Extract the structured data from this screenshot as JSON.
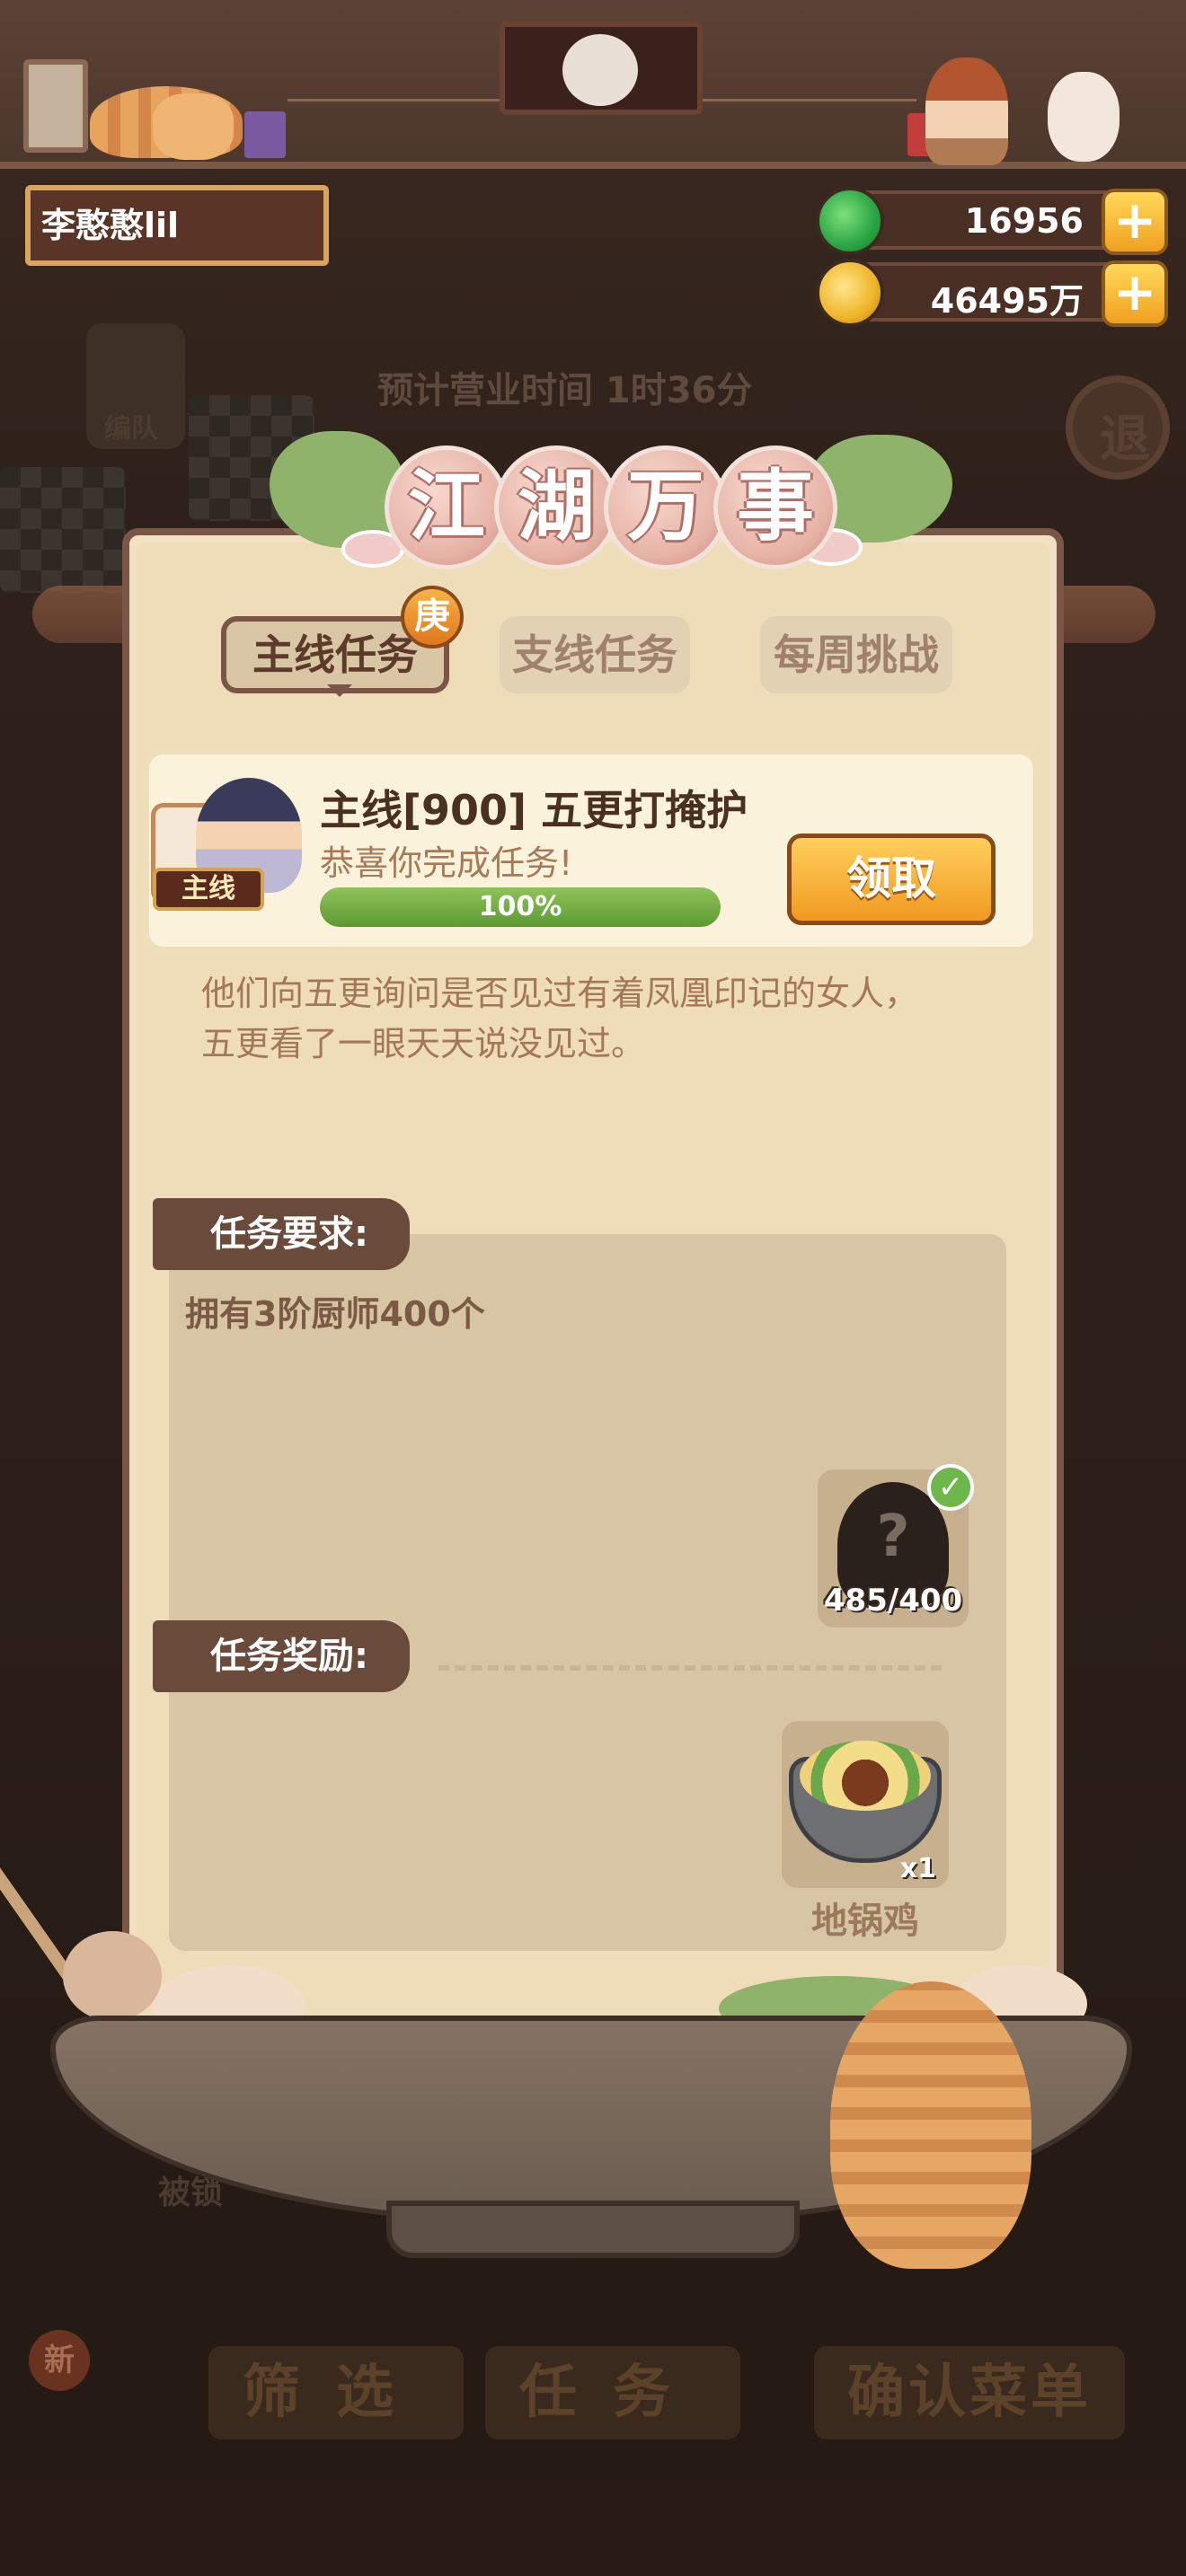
{
  "player": {
    "name": "李憨憨lil"
  },
  "currency": {
    "jade_amount": "16956",
    "coin_amount": "46495万"
  },
  "background": {
    "business_time": "预计营业时间  1时36分",
    "team_label": "编队",
    "exit_label": "退",
    "locked_label": "被锁",
    "filter_label": "筛选",
    "task_label": "任务",
    "confirm_menu_label": "确认菜单",
    "new_badge": "新"
  },
  "panel": {
    "title_chars": [
      "江",
      "湖",
      "万",
      "事"
    ],
    "tabs": [
      {
        "label": "主线任务",
        "active": true
      },
      {
        "label": "支线任务",
        "active": false
      },
      {
        "label": "每周挑战",
        "active": false
      }
    ],
    "tab_badge": "庚",
    "quest": {
      "tag": "主线",
      "title": "主线[900] 五更打掩护",
      "status": "恭喜你完成任务!",
      "progress_percent": 100,
      "progress_text": "100%",
      "claim_label": "领取",
      "story_line1": "他们向五更询问是否见过有着凤凰印记的女人，",
      "story_line2": "五更看了一眼天天说没见过。"
    },
    "requirement": {
      "label": "任务要求:",
      "text": "拥有3阶厨师400个",
      "item_unknown": "?",
      "item_count": "485/400",
      "completed": true
    },
    "reward": {
      "label": "任务奖励:",
      "item_name": "地锅鸡",
      "item_qty": "x1"
    }
  },
  "colors": {
    "panel_bg": "#efdcb9",
    "accent_orange": "#f09a20",
    "progress_green": "#5d9a34",
    "label_brown": "#6a4a3a"
  }
}
